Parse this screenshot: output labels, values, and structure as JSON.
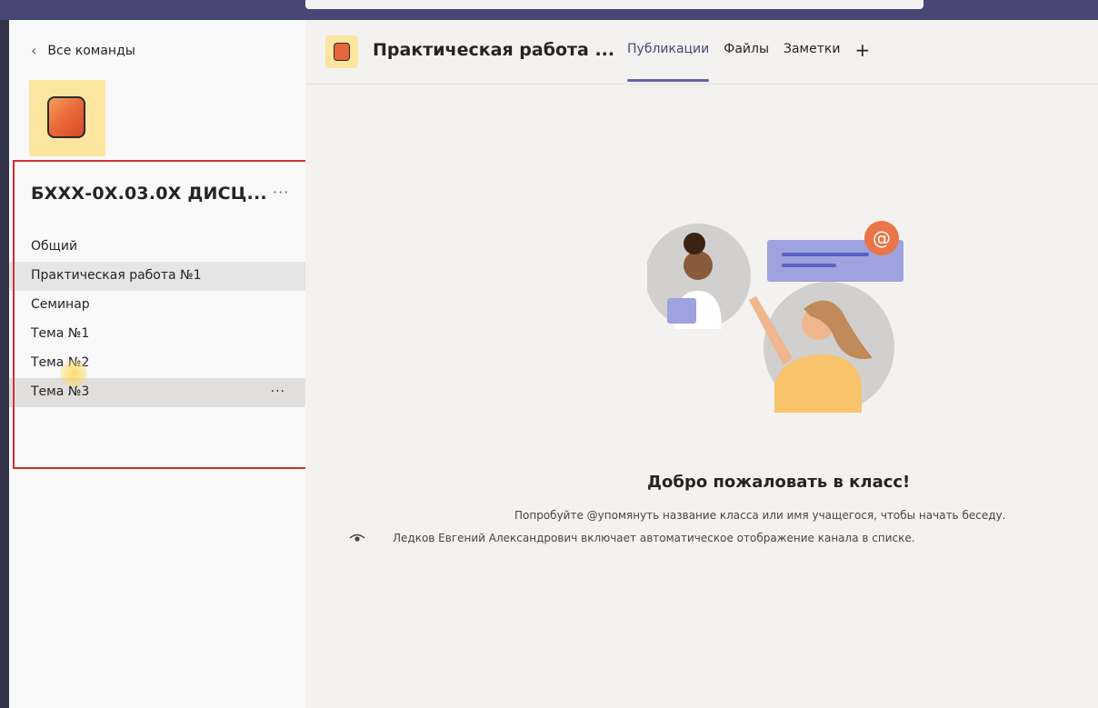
{
  "sidebar": {
    "back_label": "Все команды",
    "team_name": "БХХХ-0Х.03.0Х ДИСЦ...",
    "team_more": "···",
    "channels": [
      {
        "label": "Общий"
      },
      {
        "label": "Практическая работа №1",
        "state": "selected"
      },
      {
        "label": "Семинар"
      },
      {
        "label": "Тема №1"
      },
      {
        "label": "Тема №2"
      },
      {
        "label": "Тема №3",
        "state": "hovered",
        "more": "···"
      }
    ]
  },
  "header": {
    "channel_title": "Практическая работа ...",
    "tabs": [
      {
        "label": "Публикации",
        "active": true
      },
      {
        "label": "Файлы"
      },
      {
        "label": "Заметки"
      }
    ],
    "add_tab": "+"
  },
  "content": {
    "welcome_title": "Добро пожаловать в класс!",
    "hint": "Попробуйте @упомянуть название класса или имя учащегося, чтобы начать беседу.",
    "info": "Ледков Евгений Александрович включает автоматическое отображение канала в списке.",
    "mention_symbol": "@"
  },
  "colors": {
    "accent": "#6264a7",
    "topbar": "#464775",
    "highlight_box": "#d32f2f",
    "team_avatar_bg": "#fce59e"
  }
}
